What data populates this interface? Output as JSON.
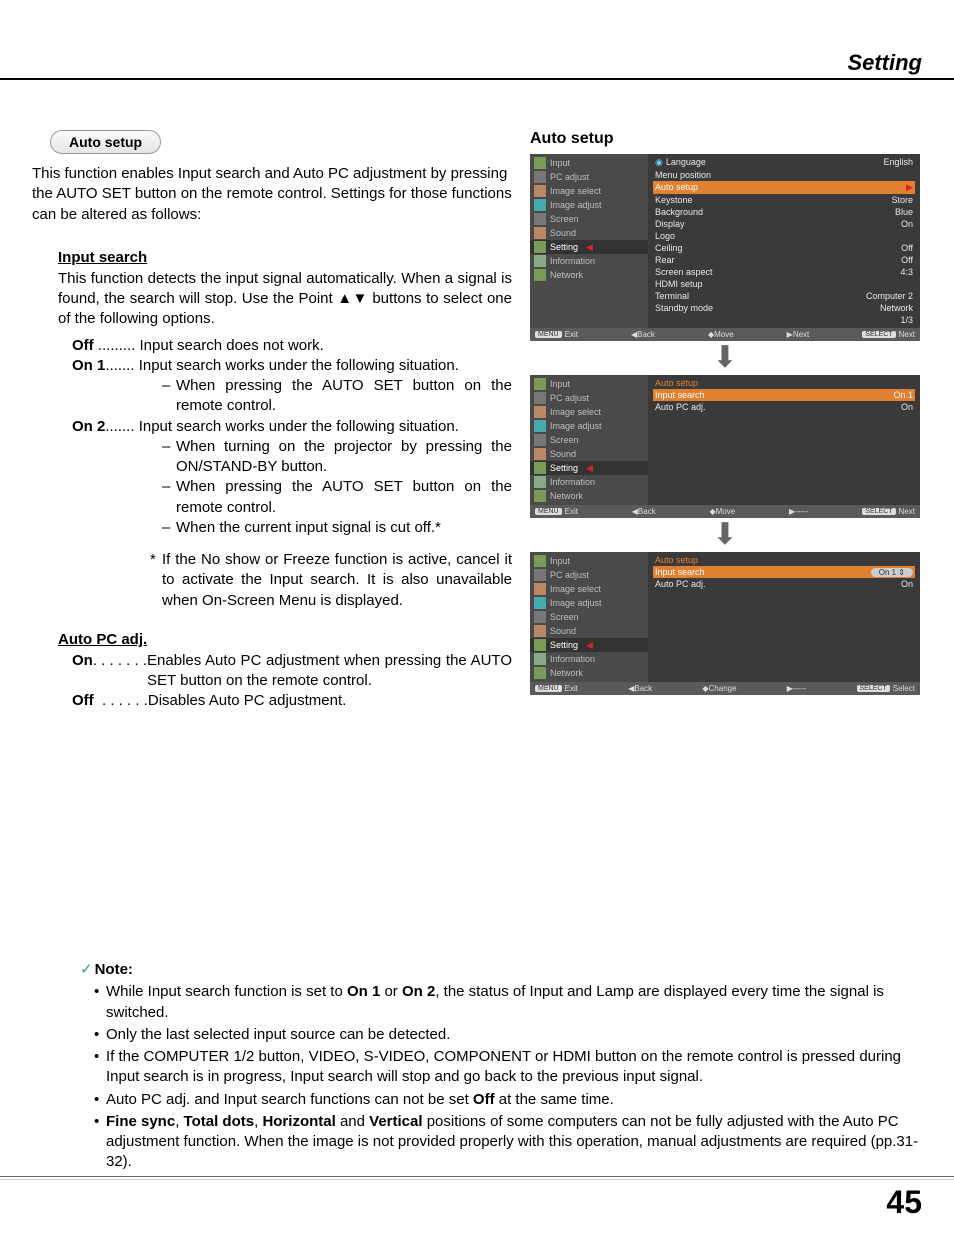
{
  "header": {
    "title": "Setting"
  },
  "left": {
    "pill": "Auto setup",
    "intro": "This function enables Input search and Auto PC adjustment by pressing the AUTO SET button on the remote control. Settings for those functions can be altered as follows:",
    "input_search": {
      "heading": "Input search",
      "desc": "This function detects the input signal automatically. When a signal is found, the search will stop. Use the Point ▲▼ buttons to select one of the following options.",
      "off_lbl": "Off",
      "off_dots": " ......... ",
      "off_val": "Input search does not work.",
      "on1_lbl": "On 1",
      "on1_dots": "....... ",
      "on1_val": "Input search works under the following situation.",
      "on1_d1": "When pressing the AUTO SET button on the remote control.",
      "on2_lbl": "On 2",
      "on2_dots": "....... ",
      "on2_val": "Input search works under the following situation.",
      "on2_d1": "When turning on the projector by pressing the ON/STAND-BY button.",
      "on2_d2": "When pressing the AUTO SET button on the remote control.",
      "on2_d3": " When the current input signal is cut off.*",
      "star": "If the No show or Freeze function is active, cancel it to activate the Input search. It is also unavailable when On-Screen Menu is displayed."
    },
    "auto_pc": {
      "heading": "Auto PC adj.",
      "on_lbl": "On",
      "on_dots": ". . . . . . .",
      "on_val": "Enables Auto PC adjustment when pressing the AUTO SET button on the remote control.",
      "off_lbl": "Off",
      "off_dots": "  . . . . . .",
      "off_val": "Disables Auto PC adjustment."
    }
  },
  "right": {
    "title": "Auto setup",
    "side_items": [
      "Input",
      "PC adjust",
      "Image select",
      "Image adjust",
      "Screen",
      "Sound",
      "Setting",
      "Information",
      "Network"
    ],
    "osd1_rows": [
      {
        "l": "Language",
        "r": "English",
        "globe": true
      },
      {
        "l": "Menu position",
        "r": ""
      },
      {
        "l": "Auto setup",
        "r": "",
        "hl": true,
        "tri": true
      },
      {
        "l": "Keystone",
        "r": "Store"
      },
      {
        "l": "Background",
        "r": "Blue"
      },
      {
        "l": "Display",
        "r": "On"
      },
      {
        "l": "Logo",
        "r": ""
      },
      {
        "l": "Ceiling",
        "r": "Off"
      },
      {
        "l": "Rear",
        "r": "Off"
      },
      {
        "l": "Screen aspect",
        "r": "4:3"
      },
      {
        "l": "HDMI setup",
        "r": ""
      },
      {
        "l": "Terminal",
        "r": "Computer 2"
      },
      {
        "l": "Standby mode",
        "r": "Network"
      },
      {
        "l": "",
        "r": "1/3"
      }
    ],
    "osd1_foot": {
      "a": "Exit",
      "b": "Back",
      "c": "Move",
      "d": "Next",
      "e": "Next"
    },
    "osd2_hdr": "Auto setup",
    "osd2_rows": [
      {
        "l": "Input search",
        "r": "On 1",
        "hl": true
      },
      {
        "l": "Auto PC adj.",
        "r": "On"
      }
    ],
    "osd2_foot": {
      "a": "Exit",
      "b": "Back",
      "c": "Move",
      "d": "-----",
      "e": "Next"
    },
    "osd3_hdr": "Auto setup",
    "osd3_rows": [
      {
        "l": "Input search",
        "r": "On 1",
        "hl": true,
        "spin": true
      },
      {
        "l": "Auto PC adj.",
        "r": "On"
      }
    ],
    "osd3_foot": {
      "a": "Exit",
      "b": "Back",
      "c": "Change",
      "d": "-----",
      "e": "Select"
    }
  },
  "notes": {
    "hdr": "Note:",
    "n1a": "While Input search function is set to ",
    "n1b": "On 1",
    "n1c": " or ",
    "n1d": "On 2",
    "n1e": ", the status of Input and Lamp are displayed every time the signal is switched.",
    "n2": "Only the last selected input source can be detected.",
    "n3": "If the COMPUTER 1/2 button, VIDEO, S-VIDEO, COMPONENT or HDMI button on the remote control is pressed during Input search is in progress, Input search will stop and go back to the previous input signal.",
    "n4a": "Auto PC adj. and Input search functions can not be set ",
    "n4b": "Off",
    "n4c": " at the same time.",
    "n5a": "Fine sync",
    "n5b": ", ",
    "n5c": "Total dots",
    "n5d": ", ",
    "n5e": "Horizontal",
    "n5f": " and ",
    "n5g": "Vertical",
    "n5h": " positions of some computers can not be fully adjusted with the Auto PC adjustment function. When the image is not provided properly with this operation, manual adjustments are required (pp.31-32)."
  },
  "page_number": "45",
  "ui": {
    "menu_kb": "MENU",
    "select_kb": "SELECT",
    "back_sym": "◀",
    "move_sym": "◆",
    "next_sym": "▶",
    "dash": "–",
    "bullet": "•",
    "check": "✓",
    "arrow": "⬇",
    "star": "*",
    "updown": "⇕"
  }
}
